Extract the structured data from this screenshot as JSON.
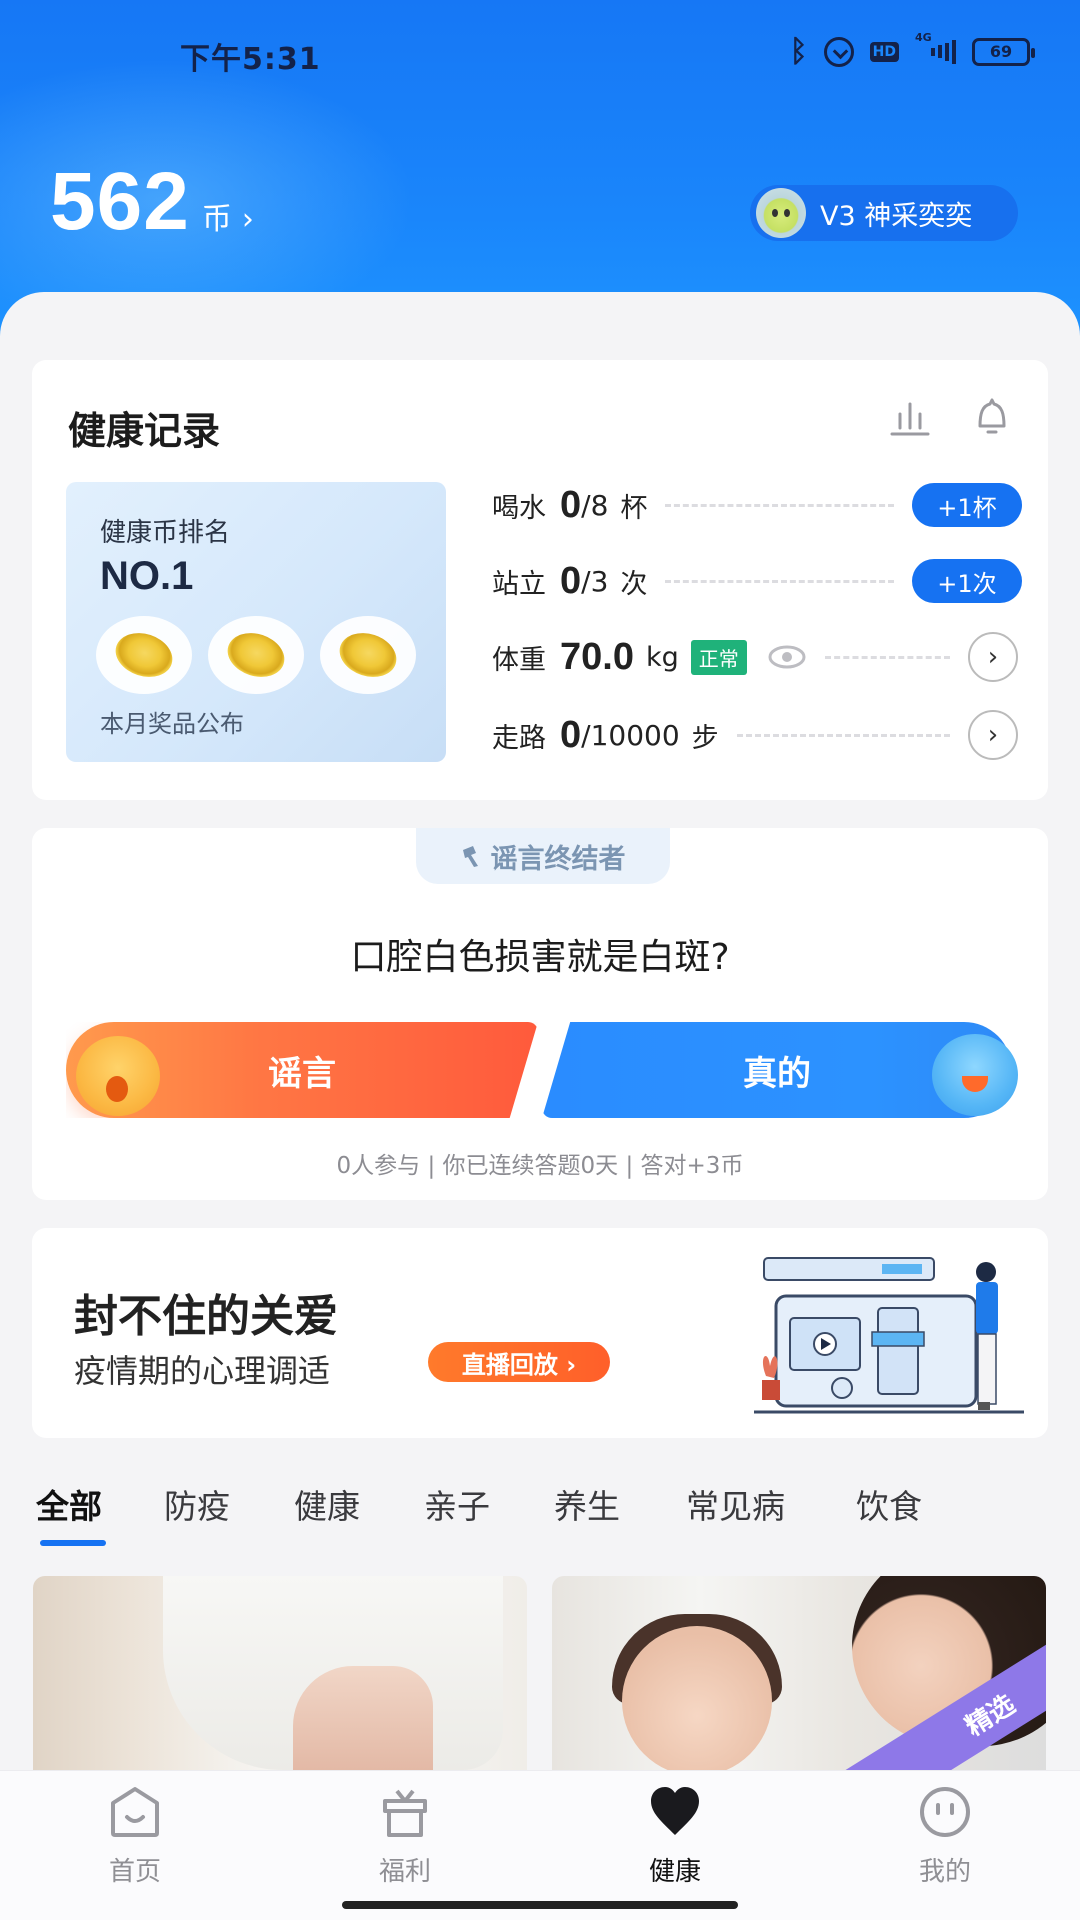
{
  "status_bar": {
    "time": "下午5:31",
    "network": "4G",
    "hd_label": "HD",
    "battery": "69",
    "icons": [
      "bluetooth-icon",
      "alarm-icon",
      "hd-icon",
      "signal-icon",
      "battery-icon"
    ]
  },
  "header": {
    "coin_balance": "562",
    "coin_unit": "币",
    "coin_chevron": "›",
    "level_badge": "V3 神采奕奕"
  },
  "health_record": {
    "title": "健康记录",
    "icons": [
      "chart-icon",
      "bell-icon"
    ],
    "ranking": {
      "label": "健康币排名",
      "rank": "NO.1",
      "footer": "本月奖品公布"
    },
    "metrics": [
      {
        "label": "喝水",
        "current": "0",
        "goal": "/8",
        "unit": "杯",
        "action": "+1杯"
      },
      {
        "label": "站立",
        "current": "0",
        "goal": "/3",
        "unit": "次",
        "action": "+1次"
      },
      {
        "label": "体重",
        "current": "70.0",
        "unit": "kg",
        "status": "正常",
        "action": "›"
      },
      {
        "label": "走路",
        "current": "0",
        "goal": "/10000",
        "unit": "步",
        "action": "›"
      }
    ]
  },
  "rumor_quiz": {
    "tag": "谣言终结者",
    "question": "口腔白色损害就是白斑?",
    "option_false": "谣言",
    "option_true": "真的",
    "stats": "0人参与 | 你已连续答题0天 | 答对+3币"
  },
  "promo": {
    "title": "封不住的关爱",
    "subtitle": "疫情期的心理调适",
    "button": "直播回放 ›"
  },
  "category_tabs": [
    {
      "label": "全部",
      "active": true
    },
    {
      "label": "防疫"
    },
    {
      "label": "健康"
    },
    {
      "label": "亲子"
    },
    {
      "label": "养生"
    },
    {
      "label": "常见病"
    },
    {
      "label": "饮食"
    }
  ],
  "articles": [
    {
      "image": "stomach-ache-photo"
    },
    {
      "image": "mother-feeding-baby-photo",
      "ribbon": "精选"
    }
  ],
  "bottom_nav": [
    {
      "label": "首页",
      "icon": "home-icon"
    },
    {
      "label": "福利",
      "icon": "gift-icon"
    },
    {
      "label": "健康",
      "icon": "heart-icon",
      "active": true
    },
    {
      "label": "我的",
      "icon": "profile-face-icon"
    }
  ],
  "colors": {
    "brand_blue": "#1672f2",
    "header_blue": "#1a86fb",
    "rumor_orange": "#ff6a3f",
    "status_green": "#1fb27a",
    "ribbon_purple": "#8e78e8"
  }
}
